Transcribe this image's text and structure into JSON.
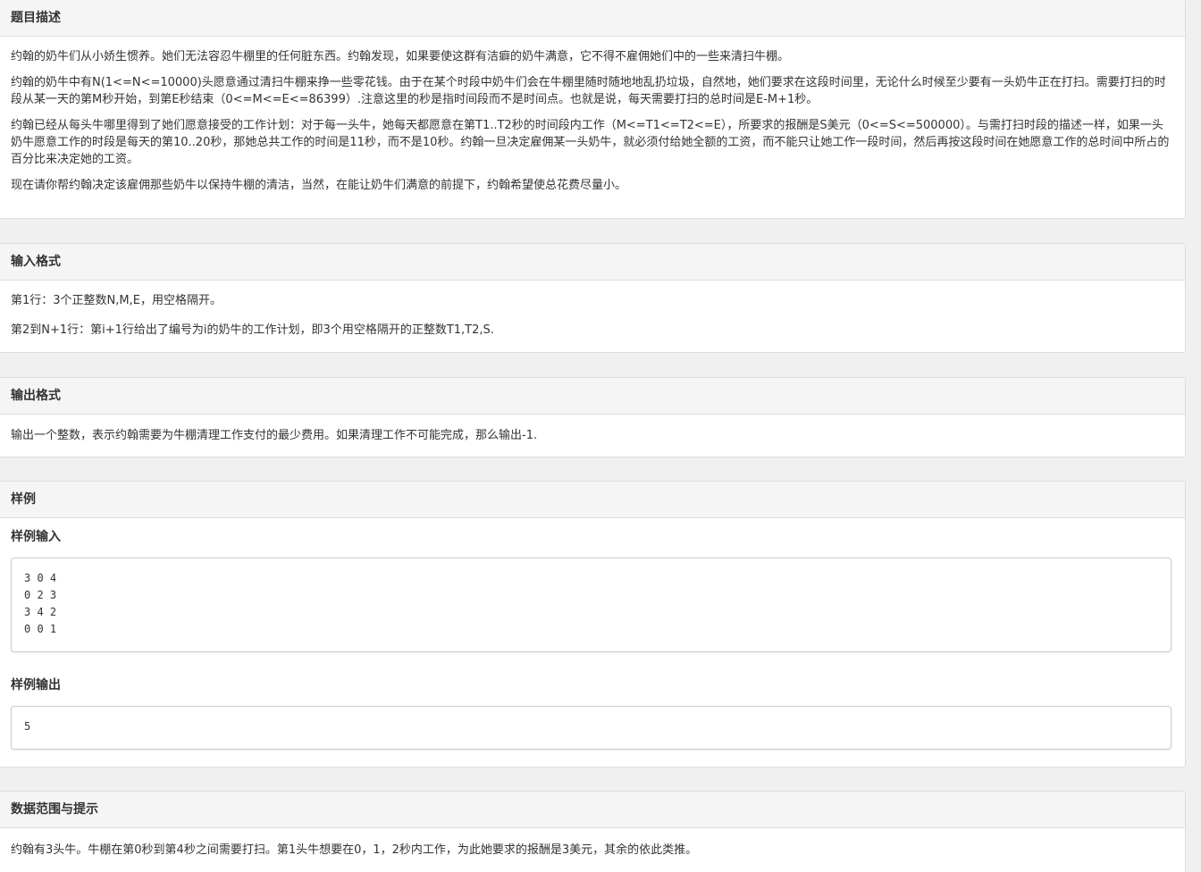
{
  "description": {
    "heading": "题目描述",
    "paragraphs": [
      "约翰的奶牛们从小娇生惯养。她们无法容忍牛棚里的任何脏东西。约翰发现，如果要使这群有洁癖的奶牛满意，它不得不雇佣她们中的一些来清扫牛棚。",
      "约翰的奶牛中有N(1<=N<=10000)头愿意通过清扫牛棚来挣一些零花钱。由于在某个时段中奶牛们会在牛棚里随时随地地乱扔垃圾，自然地，她们要求在这段时间里，无论什么时候至少要有一头奶牛正在打扫。需要打扫的时段从某一天的第M秒开始，到第E秒结束（0<=M<=E<=86399）.注意这里的秒是指时间段而不是时间点。也就是说，每天需要打扫的总时间是E-M+1秒。",
      "约翰已经从每头牛哪里得到了她们愿意接受的工作计划：对于每一头牛，她每天都愿意在第T1..T2秒的时间段内工作（M<=T1<=T2<=E），所要求的报酬是S美元（0<=S<=500000）。与需打扫时段的描述一样，如果一头奶牛愿意工作的时段是每天的第10..20秒，那她总共工作的时间是11秒，而不是10秒。约翰一旦决定雇佣某一头奶牛，就必须付给她全额的工资，而不能只让她工作一段时间，然后再按这段时间在她愿意工作的总时间中所占的百分比来决定她的工资。",
      "现在请你帮约翰决定该雇佣那些奶牛以保持牛棚的清洁，当然，在能让奶牛们满意的前提下，约翰希望使总花费尽量小。"
    ]
  },
  "input_format": {
    "heading": "输入格式",
    "paragraphs": [
      "第1行：3个正整数N,M,E，用空格隔开。",
      "第2到N+1行：第i+1行给出了编号为i的奶牛的工作计划，即3个用空格隔开的正整数T1,T2,S."
    ]
  },
  "output_format": {
    "heading": "输出格式",
    "paragraphs": [
      "输出一个整数，表示约翰需要为牛棚清理工作支付的最少费用。如果清理工作不可能完成，那么输出-1."
    ]
  },
  "sample": {
    "heading": "样例",
    "input_heading": "样例输入",
    "input_text": "3 0 4\n0 2 3\n3 4 2\n0 0 1",
    "output_heading": "样例输出",
    "output_text": "5"
  },
  "hints": {
    "heading": "数据范围与提示",
    "paragraphs": [
      "约翰有3头牛。牛棚在第0秒到第4秒之间需要打扫。第1头牛想要在0，1，2秒内工作，为此她要求的报酬是3美元，其余的依此类推。"
    ]
  }
}
